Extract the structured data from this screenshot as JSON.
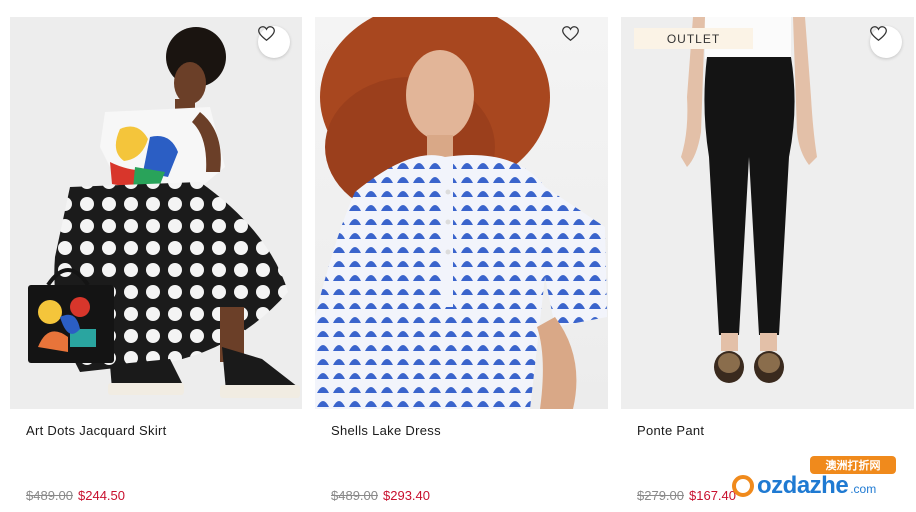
{
  "products": [
    {
      "name": "Art Dots Jacquard Skirt",
      "original_price": "$489.00",
      "sale_price": "$244.50",
      "badge": "",
      "image_icon": "model-polka-dot-skirt-image"
    },
    {
      "name": "Shells Lake Dress",
      "original_price": "$489.00",
      "sale_price": "$293.40",
      "badge": "",
      "image_icon": "model-blue-shell-dress-image"
    },
    {
      "name": "Ponte Pant",
      "original_price": "$279.00",
      "sale_price": "$167.40",
      "badge": "OUTLET",
      "image_icon": "model-black-pants-image"
    }
  ],
  "wishlist_icon": "heart-outline-icon",
  "watermark": {
    "badge": "澳洲打折网",
    "brand": "ozdazhe",
    "suffix": ".com"
  },
  "colors": {
    "sale_price": "#c8102e",
    "original_price": "#8a8a8a",
    "badge_bg": "#fbf3e6"
  }
}
